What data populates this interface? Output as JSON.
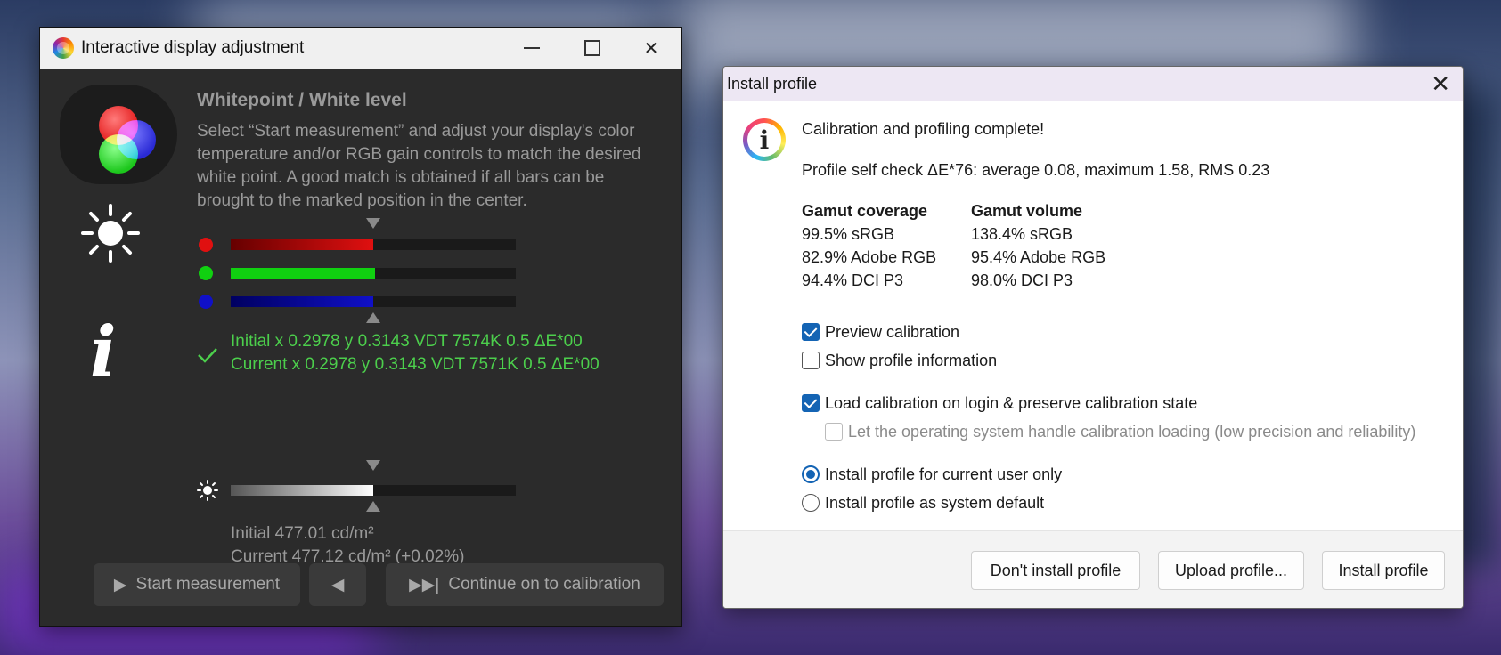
{
  "display_adjust": {
    "title": "Interactive display adjustment",
    "heading": "Whitepoint / White level",
    "description": "Select “Start measurement” and adjust your display's color temperature and/or RGB gain controls to match the desired white point. A good match is obtained if all bars can be brought to the marked position in the center.",
    "bars": [
      {
        "channel": "red",
        "color": "#e01010",
        "fill_fraction": 0.5
      },
      {
        "channel": "green",
        "color": "#10d010",
        "fill_fraction": 0.505
      },
      {
        "channel": "blue",
        "color": "#1010c8",
        "fill_fraction": 0.5
      }
    ],
    "initial_readout": "Initial x 0.2978 y 0.3143 VDT 7574K 0.5 ΔE*00",
    "current_readout": "Current x 0.2978 y 0.3143 VDT 7571K 0.5 ΔE*00",
    "luminance_fill_fraction": 0.5,
    "initial_luminance": "Initial 477.01 cd/m²",
    "current_luminance": "Current 477.12 cd/m² (+0.02%)",
    "start_label": "Start measurement",
    "continue_label": "Continue on to calibration",
    "colors": {
      "readout": "#4ccf4c",
      "dim_text": "#9a9a9a",
      "background": "#2b2b2b"
    }
  },
  "install_profile": {
    "title": "Install profile",
    "complete_message": "Calibration and profiling complete!",
    "self_check": "Profile self check ΔE*76: average 0.08, maximum 1.58, RMS 0.23",
    "gamut_coverage_header": "Gamut coverage",
    "gamut_volume_header": "Gamut volume",
    "gamut_coverage": [
      "99.5% sRGB",
      "82.9% Adobe RGB",
      "94.4% DCI P3"
    ],
    "gamut_volume": [
      "138.4% sRGB",
      "95.4% Adobe RGB",
      "98.0% DCI P3"
    ],
    "preview_calibration": {
      "label": "Preview calibration",
      "checked": true
    },
    "show_profile_info": {
      "label": "Show profile information",
      "checked": false
    },
    "load_calibration": {
      "label": "Load calibration on login & preserve calibration state",
      "checked": true
    },
    "os_handle": {
      "label": "Let the operating system handle calibration loading (low precision and reliability)",
      "checked": false,
      "disabled": true
    },
    "radio_current_user": {
      "label": "Install profile for current user only",
      "selected": true
    },
    "radio_system_default": {
      "label": "Install profile as system default",
      "selected": false
    },
    "dont_install_label": "Don't install profile",
    "upload_label": "Upload profile...",
    "install_label": "Install profile",
    "colors": {
      "accent": "#1464b4",
      "titlebar": "#ede7f3",
      "footer": "#f3f3f3"
    }
  }
}
